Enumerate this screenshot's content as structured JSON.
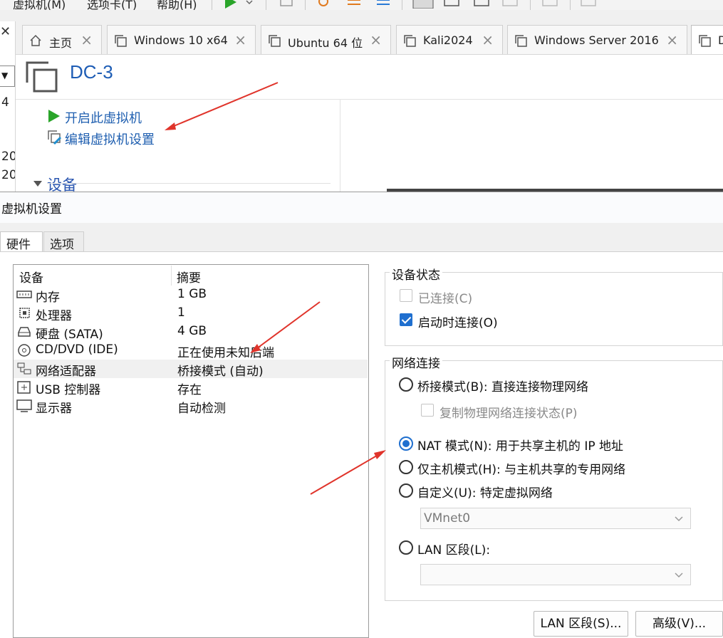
{
  "menu": {
    "items": [
      "虚拟机(M)",
      "选项卡(T)",
      "帮助(H)"
    ]
  },
  "library_strip": {
    "fragments": [
      "4",
      "20",
      "20"
    ]
  },
  "tabs": [
    {
      "label": "主页",
      "icon": "home-icon"
    },
    {
      "label": "Windows 10 x64",
      "icon": "vm-icon"
    },
    {
      "label": "Ubuntu 64 位",
      "icon": "vm-icon"
    },
    {
      "label": "Kali2024",
      "icon": "vm-icon"
    },
    {
      "label": "Windows Server 2016",
      "icon": "vm-icon"
    },
    {
      "label": "D",
      "icon": "vm-icon"
    }
  ],
  "vm": {
    "name": "DC-3",
    "commands": {
      "power_on": "开启此虚拟机",
      "edit_settings": "编辑虚拟机设置"
    },
    "devices_header": "设备"
  },
  "dialog": {
    "title": "虚拟机设置",
    "tabs": {
      "hardware": "硬件",
      "options": "选项"
    },
    "device_list": {
      "headers": {
        "device": "设备",
        "summary": "摘要"
      },
      "rows": [
        {
          "name": "内存",
          "summary": "1 GB",
          "icon": "memory-icon"
        },
        {
          "name": "处理器",
          "summary": "1",
          "icon": "cpu-icon"
        },
        {
          "name": "硬盘 (SATA)",
          "summary": "4 GB",
          "icon": "hard-disk-icon"
        },
        {
          "name": "CD/DVD (IDE)",
          "summary": "正在使用未知后端",
          "icon": "cd-dvd-icon"
        },
        {
          "name": "网络适配器",
          "summary": "桥接模式 (自动)",
          "icon": "network-adapter-icon"
        },
        {
          "name": "USB 控制器",
          "summary": "存在",
          "icon": "usb-icon"
        },
        {
          "name": "显示器",
          "summary": "自动检测",
          "icon": "monitor-icon"
        }
      ],
      "selected_index": 4
    },
    "device_status": {
      "label": "设备状态",
      "connected": {
        "label": "已连接(C)",
        "checked": false,
        "disabled": true
      },
      "connect_at_power_on": {
        "label": "启动时连接(O)",
        "checked": true,
        "disabled": false
      }
    },
    "network": {
      "label": "网络连接",
      "bridged": {
        "label": "桥接模式(B): 直接连接物理网络",
        "selected": false
      },
      "replicate": {
        "label": "复制物理网络连接状态(P)",
        "checked": false,
        "disabled": true
      },
      "nat": {
        "label": "NAT 模式(N): 用于共享主机的 IP 地址",
        "selected": true
      },
      "host_only": {
        "label": "仅主机模式(H): 与主机共享的专用网络",
        "selected": false
      },
      "custom": {
        "label": "自定义(U): 特定虚拟网络",
        "selected": false
      },
      "custom_value": "VMnet0",
      "lan_segment": {
        "label": "LAN 区段(L):",
        "selected": false
      },
      "lan_value": ""
    },
    "buttons": {
      "lan_segments": "LAN 区段(S)...",
      "advanced": "高级(V)..."
    }
  },
  "colors": {
    "accent": "#1f6fcf",
    "link": "#1f5fb0",
    "annotation_arrow": "#e0342b",
    "power_green": "#2aa52a"
  }
}
